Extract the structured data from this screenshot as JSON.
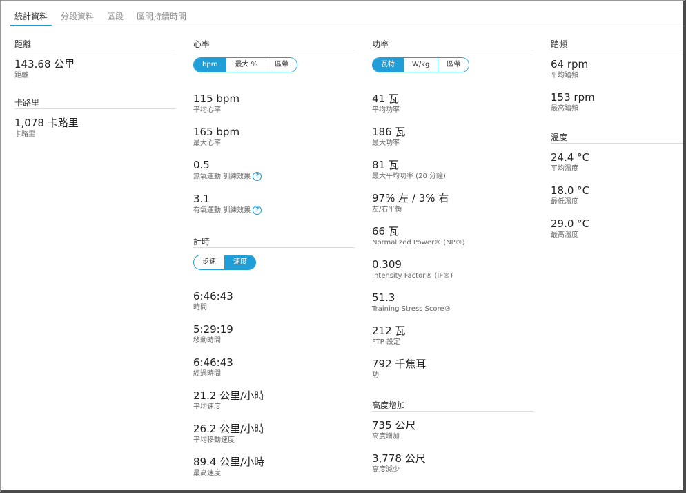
{
  "tabs": [
    "統計資料",
    "分段資料",
    "區段",
    "區間持續時間"
  ],
  "distance": {
    "title": "距離",
    "stats": [
      {
        "value": "143.68 公里",
        "label": "距離"
      }
    ]
  },
  "calories": {
    "title": "卡路里",
    "stats": [
      {
        "value": "1,078 卡路里",
        "label": "卡路里"
      }
    ]
  },
  "heart_rate": {
    "title": "心率",
    "toggle": [
      "bpm",
      "最大 %",
      "區帶"
    ],
    "toggle_selected": "bpm",
    "stats": [
      {
        "value": "115 bpm",
        "label": "平均心率"
      },
      {
        "value": "165 bpm",
        "label": "最大心率"
      },
      {
        "value": "0.5",
        "label_prefix": "無氧運動 ",
        "label_link": "訓練效果"
      },
      {
        "value": "3.1",
        "label_prefix": "有氧運動 ",
        "label_link": "訓練效果"
      }
    ]
  },
  "timing": {
    "title": "計時",
    "toggle": [
      "步速",
      "速度"
    ],
    "toggle_selected": "速度",
    "stats": [
      {
        "value": "6:46:43",
        "label": "時間"
      },
      {
        "value": "5:29:19",
        "label": "移動時間"
      },
      {
        "value": "6:46:43",
        "label": "經過時間"
      },
      {
        "value": "21.2 公里/小時",
        "label": "平均速度"
      },
      {
        "value": "26.2 公里/小時",
        "label": "平均移動速度"
      },
      {
        "value": "89.4 公里/小時",
        "label": "最高速度"
      }
    ]
  },
  "power": {
    "title": "功率",
    "toggle": [
      "瓦特",
      "W/kg",
      "區帶"
    ],
    "toggle_selected": "瓦特",
    "stats": [
      {
        "value": "41 瓦",
        "label": "平均功率"
      },
      {
        "value": "186 瓦",
        "label": "最大功率"
      },
      {
        "value": "81 瓦",
        "label": "最大平均功率 (20 分鐘)"
      },
      {
        "value": "97% 左 / 3% 右",
        "label": "左/右平衡"
      },
      {
        "value": "66 瓦",
        "label": "Normalized Power® (NP®)"
      },
      {
        "value": "0.309",
        "label": "Intensity Factor® (IF®)"
      },
      {
        "value": "51.3",
        "label": "Training Stress Score®"
      },
      {
        "value": "212 瓦",
        "label": "FTP 設定"
      },
      {
        "value": "792 千焦耳",
        "label": "功"
      }
    ]
  },
  "elevation": {
    "title": "高度增加",
    "stats": [
      {
        "value": "735 公尺",
        "label": "高度增加"
      },
      {
        "value": "3,778 公尺",
        "label": "高度減少"
      }
    ]
  },
  "cadence": {
    "title": "踏頻",
    "stats": [
      {
        "value": "64 rpm",
        "label": "平均踏頻"
      },
      {
        "value": "153 rpm",
        "label": "最高踏頻"
      }
    ]
  },
  "temperature": {
    "title": "溫度",
    "stats": [
      {
        "value": "24.4 °C",
        "label": "平均溫度"
      },
      {
        "value": "18.0 °C",
        "label": "最低溫度"
      },
      {
        "value": "29.0 °C",
        "label": "最高溫度"
      }
    ]
  },
  "colors": {
    "accent": "#1f9ed8"
  }
}
